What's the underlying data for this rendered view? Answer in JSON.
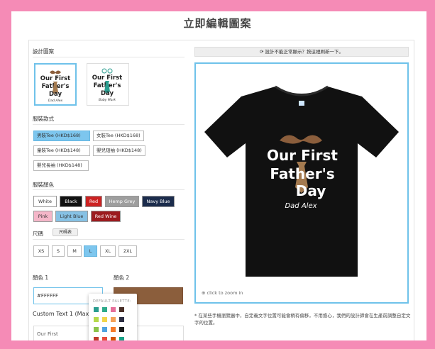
{
  "page_title": "立即編輯圖案",
  "left": {
    "design_label": "設計圖案",
    "designs": [
      {
        "line1": "Our First",
        "line2": "Father's",
        "line3": "Day",
        "name": "Dad Alex",
        "selected": true
      },
      {
        "line1": "Our First",
        "line2": "Father's",
        "line3": "Day",
        "name": "Baby Mark",
        "selected": false
      }
    ],
    "style_label": "服裝款式",
    "styles": [
      {
        "label": "男裝Tee (HKD$168)",
        "selected": true
      },
      {
        "label": "女裝Tee (HKD$168)",
        "selected": false
      },
      {
        "label": "童裝Tee (HKD$148)",
        "selected": false
      },
      {
        "label": "嬰兒短袖 (HKD$148)",
        "selected": false
      },
      {
        "label": "嬰兒長袖 (HKD$148)",
        "selected": false
      }
    ],
    "color_label": "服裝顏色",
    "colors": [
      {
        "label": "White",
        "bg": "#ffffff",
        "fg": "#333333"
      },
      {
        "label": "Black",
        "bg": "#111111",
        "fg": "#ffffff"
      },
      {
        "label": "Red",
        "bg": "#cc2222",
        "fg": "#ffffff"
      },
      {
        "label": "Hemp Grey",
        "bg": "#9e9e9e",
        "fg": "#ffffff"
      },
      {
        "label": "Navy Blue",
        "bg": "#1b2c4c",
        "fg": "#ffffff"
      },
      {
        "label": "Pink",
        "bg": "#f4b6c8",
        "fg": "#333333"
      },
      {
        "label": "Light Blue",
        "bg": "#86c1e4",
        "fg": "#333333"
      },
      {
        "label": "Red Wine",
        "bg": "#9c1b1f",
        "fg": "#ffffff"
      }
    ],
    "size_label": "尺碼",
    "size_chart_label": "尺碼表",
    "sizes": [
      {
        "label": "XS",
        "selected": false
      },
      {
        "label": "S",
        "selected": false
      },
      {
        "label": "M",
        "selected": false
      },
      {
        "label": "L",
        "selected": true
      },
      {
        "label": "XL",
        "selected": false
      },
      {
        "label": "2XL",
        "selected": false
      }
    ],
    "color1_label": "顏色 1",
    "color2_label": "顏色 2",
    "color1_value": "#FFFFFF",
    "color2_value": "#8b5e3c",
    "text1_label": "Custom Text 1 (Max. L",
    "text1_value": "Our First",
    "palette_title": "DEFAULT PALETTE:",
    "palette": [
      "#2a9d8f",
      "#2eaa8a",
      "#e76f9a",
      "#4a3028",
      "#b5d94a",
      "#f2d54a",
      "#f4a259",
      "#2b2d42",
      "#8bc34a",
      "#4fa3e0",
      "#f57c2a",
      "#1a1a1a",
      "#c0392b",
      "#e74c3c",
      "#d35400",
      "#16a085"
    ]
  },
  "right": {
    "refresh_text": "設計不能正常顯示？按這裡刷新一下。",
    "shirt_color": "#111111",
    "mustache_color": "#8b5e3c",
    "tie_color": "#a47a4f",
    "design_line1": "Our First",
    "design_line2": "Father's",
    "design_line3": "Day",
    "design_name": "Dad Alex",
    "zoom_text": "click to zoom in",
    "note": "* 在某些手機瀏覽器中，自定義文字位置可能會稍有偏移，不用擔心，我們的設計師會在生產前調整自定文字的位置。"
  }
}
